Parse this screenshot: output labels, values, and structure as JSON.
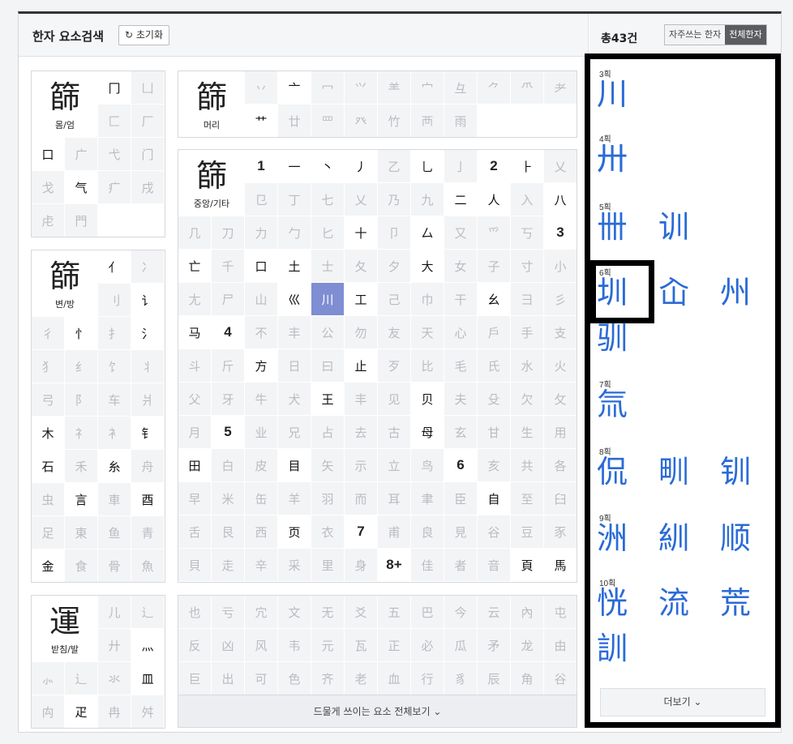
{
  "header": {
    "title": "한자 요소검색",
    "reset": "초기화",
    "reset_icon": "refresh-icon"
  },
  "right_header": {
    "count": "총43건",
    "tab_frequent": "자주쓰는 한자",
    "tab_all": "전체한자"
  },
  "sections": {
    "momeom": {
      "glyph_a": "",
      "glyph_b": "篩",
      "label": "몸/엄",
      "cells": [
        [
          "冂",
          "on"
        ],
        [
          "凵",
          "off"
        ],
        [
          "匚",
          "off"
        ],
        [
          "厂",
          "off"
        ],
        [
          "口",
          "on"
        ],
        [
          "广",
          "off"
        ],
        [
          "弋",
          "off"
        ],
        [
          "门",
          "off"
        ],
        [
          "戈",
          "off"
        ],
        [
          "气",
          "on"
        ],
        [
          "疒",
          "off"
        ],
        [
          "戌",
          "off"
        ],
        [
          "虍",
          "off"
        ],
        [
          "門",
          "off"
        ],
        [
          "",
          ""
        ],
        [
          "",
          ""
        ]
      ]
    },
    "meori": {
      "glyph": "篩",
      "label": "머리",
      "row1": [
        [
          "丷",
          "off"
        ],
        [
          "亠",
          "on"
        ],
        [
          "冖",
          "off"
        ],
        [
          "⺍",
          "off"
        ],
        [
          "⺷",
          "off"
        ],
        [
          "宀",
          "off"
        ],
        [
          "彑",
          "off"
        ],
        [
          "⺈",
          "off"
        ],
        [
          "⺥",
          "off"
        ],
        [
          "耂",
          "off"
        ]
      ],
      "row2": [
        [
          "艹",
          "on"
        ],
        [
          "廿",
          "off"
        ],
        [
          "罒",
          "off"
        ],
        [
          "癶",
          "off"
        ],
        [
          "竹",
          "off"
        ],
        [
          "襾",
          "off"
        ],
        [
          "雨",
          "off"
        ],
        [
          "",
          ""
        ],
        [
          "",
          ""
        ]
      ]
    },
    "center": {
      "glyph": "篩",
      "label": "중앙/기타",
      "cells": [
        [
          "1",
          "num"
        ],
        [
          "一",
          "on"
        ],
        [
          "丶",
          "on"
        ],
        [
          "丿",
          "on"
        ],
        [
          "乙",
          "off"
        ],
        [
          "乚",
          "on"
        ],
        [
          "亅",
          "off"
        ],
        [
          "2",
          "num"
        ],
        [
          "⺊",
          "on"
        ],
        [
          "乂",
          "off"
        ],
        [
          "⺋",
          "off"
        ],
        [
          "丁",
          "off"
        ],
        [
          "七",
          "off"
        ],
        [
          "乂",
          "off"
        ],
        [
          "乃",
          "off"
        ],
        [
          "九",
          "off"
        ],
        [
          "二",
          "on"
        ],
        [
          "人",
          "on"
        ],
        [
          "入",
          "off"
        ],
        [
          "八",
          "on"
        ],
        [
          "几",
          "off"
        ],
        [
          "刀",
          "off"
        ],
        [
          "力",
          "off"
        ],
        [
          "勹",
          "off"
        ],
        [
          "匕",
          "off"
        ],
        [
          "十",
          "on"
        ],
        [
          "卩",
          "off"
        ],
        [
          "厶",
          "on"
        ],
        [
          "又",
          "off"
        ],
        [
          "⺤",
          "off"
        ],
        [
          "丂",
          "off"
        ],
        [
          "3",
          "num"
        ],
        [
          "亡",
          "on"
        ],
        [
          "千",
          "off"
        ],
        [
          "口",
          "on"
        ],
        [
          "土",
          "on"
        ],
        [
          "士",
          "off"
        ],
        [
          "夂",
          "off"
        ],
        [
          "夕",
          "off"
        ],
        [
          "大",
          "on"
        ],
        [
          "女",
          "off"
        ],
        [
          "子",
          "off"
        ],
        [
          "寸",
          "off"
        ],
        [
          "小",
          "off"
        ],
        [
          "尢",
          "off"
        ],
        [
          "尸",
          "off"
        ],
        [
          "山",
          "off"
        ],
        [
          "巛",
          "on"
        ],
        [
          "川",
          "sel"
        ],
        [
          "工",
          "on"
        ],
        [
          "己",
          "off"
        ],
        [
          "巾",
          "off"
        ],
        [
          "干",
          "off"
        ],
        [
          "幺",
          "on"
        ],
        [
          "彐",
          "off"
        ],
        [
          "彡",
          "off"
        ],
        [
          "马",
          "on"
        ],
        [
          "4",
          "num"
        ],
        [
          "不",
          "off"
        ],
        [
          "丰",
          "off"
        ],
        [
          "公",
          "off"
        ],
        [
          "勿",
          "off"
        ],
        [
          "友",
          "off"
        ],
        [
          "天",
          "off"
        ],
        [
          "心",
          "off"
        ],
        [
          "戶",
          "off"
        ],
        [
          "手",
          "off"
        ],
        [
          "支",
          "off"
        ],
        [
          "斗",
          "off"
        ],
        [
          "斤",
          "off"
        ],
        [
          "方",
          "on"
        ],
        [
          "日",
          "off"
        ],
        [
          "曰",
          "off"
        ],
        [
          "止",
          "on"
        ],
        [
          "歹",
          "off"
        ],
        [
          "比",
          "off"
        ],
        [
          "毛",
          "off"
        ],
        [
          "氏",
          "off"
        ],
        [
          "水",
          "off"
        ],
        [
          "火",
          "off"
        ],
        [
          "父",
          "off"
        ],
        [
          "牙",
          "off"
        ],
        [
          "牛",
          "off"
        ],
        [
          "犬",
          "off"
        ],
        [
          "王",
          "on"
        ],
        [
          "丰",
          "off"
        ],
        [
          "见",
          "off"
        ],
        [
          "贝",
          "on"
        ],
        [
          "夫",
          "off"
        ],
        [
          "殳",
          "off"
        ],
        [
          "欠",
          "off"
        ],
        [
          "攵",
          "off"
        ],
        [
          "月",
          "off"
        ],
        [
          "5",
          "num"
        ],
        [
          "业",
          "off"
        ],
        [
          "兄",
          "off"
        ],
        [
          "占",
          "off"
        ],
        [
          "去",
          "off"
        ],
        [
          "古",
          "off"
        ],
        [
          "母",
          "on"
        ],
        [
          "玄",
          "off"
        ],
        [
          "甘",
          "off"
        ],
        [
          "生",
          "off"
        ],
        [
          "用",
          "off"
        ],
        [
          "田",
          "on"
        ],
        [
          "白",
          "off"
        ],
        [
          "皮",
          "off"
        ],
        [
          "目",
          "on"
        ],
        [
          "矢",
          "off"
        ],
        [
          "示",
          "off"
        ],
        [
          "立",
          "off"
        ],
        [
          "鸟",
          "off"
        ],
        [
          "6",
          "num"
        ],
        [
          "亥",
          "off"
        ],
        [
          "共",
          "off"
        ],
        [
          "各",
          "off"
        ],
        [
          "早",
          "off"
        ],
        [
          "米",
          "off"
        ],
        [
          "缶",
          "off"
        ],
        [
          "羊",
          "off"
        ],
        [
          "羽",
          "off"
        ],
        [
          "而",
          "off"
        ],
        [
          "耳",
          "off"
        ],
        [
          "聿",
          "off"
        ],
        [
          "臣",
          "off"
        ],
        [
          "自",
          "on"
        ],
        [
          "至",
          "off"
        ],
        [
          "臼",
          "off"
        ],
        [
          "舌",
          "off"
        ],
        [
          "艮",
          "off"
        ],
        [
          "西",
          "off"
        ],
        [
          "页",
          "on"
        ],
        [
          "衣",
          "off"
        ],
        [
          "7",
          "num"
        ],
        [
          "甫",
          "off"
        ],
        [
          "良",
          "off"
        ],
        [
          "見",
          "off"
        ],
        [
          "谷",
          "off"
        ],
        [
          "豆",
          "off"
        ],
        [
          "豕",
          "off"
        ],
        [
          "貝",
          "off"
        ],
        [
          "走",
          "off"
        ],
        [
          "辛",
          "off"
        ],
        [
          "采",
          "off"
        ],
        [
          "里",
          "off"
        ],
        [
          "身",
          "off"
        ],
        [
          "8+",
          "num"
        ],
        [
          "佳",
          "off"
        ],
        [
          "者",
          "off"
        ],
        [
          "音",
          "off"
        ],
        [
          "頁",
          "on"
        ],
        [
          "馬",
          "on"
        ]
      ]
    },
    "byeonbang": {
      "glyph": "篩",
      "label": "변/방",
      "cells": [
        [
          "亻",
          "on"
        ],
        [
          "冫",
          "off"
        ],
        [
          "刂",
          "off"
        ],
        [
          "讠",
          "on"
        ],
        [
          "彳",
          "off"
        ],
        [
          "忄",
          "on"
        ],
        [
          "扌",
          "off"
        ],
        [
          "氵",
          "on"
        ],
        [
          "犭",
          "off"
        ],
        [
          "纟",
          "off"
        ],
        [
          "饣",
          "off"
        ],
        [
          "丬",
          "off"
        ],
        [
          "弓",
          "off"
        ],
        [
          "阝",
          "off"
        ],
        [
          "车",
          "off"
        ],
        [
          "爿",
          "off"
        ],
        [
          "木",
          "on"
        ],
        [
          "礻",
          "off"
        ],
        [
          "衤",
          "off"
        ],
        [
          "钅",
          "on"
        ],
        [
          "石",
          "on"
        ],
        [
          "禾",
          "off"
        ],
        [
          "糸",
          "on"
        ],
        [
          "舟",
          "off"
        ],
        [
          "虫",
          "off"
        ],
        [
          "言",
          "on"
        ],
        [
          "車",
          "off"
        ],
        [
          "酉",
          "on"
        ],
        [
          "足",
          "off"
        ],
        [
          "東",
          "off"
        ],
        [
          "鱼",
          "off"
        ],
        [
          "青",
          "off"
        ],
        [
          "金",
          "on"
        ],
        [
          "食",
          "off"
        ],
        [
          "骨",
          "off"
        ],
        [
          "魚",
          "off"
        ]
      ]
    },
    "batchim": {
      "glyph": "運",
      "label": "받침/발",
      "cells": [
        [
          "儿",
          "off"
        ],
        [
          "辶",
          "off"
        ],
        [
          "廾",
          "off"
        ],
        [
          "灬",
          "on"
        ],
        [
          "⺗",
          "off"
        ],
        [
          "辶",
          "off"
        ],
        [
          "氺",
          "off"
        ],
        [
          "皿",
          "on"
        ],
        [
          "禸",
          "off"
        ],
        [
          "疋",
          "on"
        ],
        [
          "冉",
          "off"
        ],
        [
          "舛",
          "off"
        ]
      ]
    },
    "bottom": {
      "cells": [
        [
          "也",
          "off"
        ],
        [
          "亏",
          "off"
        ],
        [
          "宂",
          "off"
        ],
        [
          "文",
          "off"
        ],
        [
          "无",
          "off"
        ],
        [
          "爻",
          "off"
        ],
        [
          "五",
          "off"
        ],
        [
          "巴",
          "off"
        ],
        [
          "今",
          "off"
        ],
        [
          "云",
          "off"
        ],
        [
          "內",
          "off"
        ],
        [
          "屯",
          "off"
        ],
        [
          "反",
          "off"
        ],
        [
          "凶",
          "off"
        ],
        [
          "风",
          "off"
        ],
        [
          "韦",
          "off"
        ],
        [
          "元",
          "off"
        ],
        [
          "瓦",
          "off"
        ],
        [
          "正",
          "off"
        ],
        [
          "必",
          "off"
        ],
        [
          "瓜",
          "off"
        ],
        [
          "矛",
          "off"
        ],
        [
          "龙",
          "off"
        ],
        [
          "由",
          "off"
        ],
        [
          "巨",
          "off"
        ],
        [
          "出",
          "off"
        ],
        [
          "可",
          "off"
        ],
        [
          "色",
          "off"
        ],
        [
          "齐",
          "off"
        ],
        [
          "老",
          "off"
        ],
        [
          "血",
          "off"
        ],
        [
          "行",
          "off"
        ],
        [
          "豸",
          "off"
        ],
        [
          "辰",
          "off"
        ],
        [
          "角",
          "off"
        ],
        [
          "谷",
          "off"
        ]
      ],
      "more": "드물게 쓰이는 요소 전체보기"
    }
  },
  "results": {
    "more": "더보기",
    "groups": [
      {
        "stroke": "3획",
        "chars": [
          "川"
        ]
      },
      {
        "stroke": "4획",
        "chars": [
          "卅"
        ]
      },
      {
        "stroke": "5획",
        "chars": [
          "卌",
          "训"
        ]
      },
      {
        "stroke": "6획",
        "chars": [
          "圳",
          "屳",
          "州",
          "驯"
        ]
      },
      {
        "stroke": "7획",
        "chars": [
          "氚"
        ]
      },
      {
        "stroke": "8획",
        "chars": [
          "侃",
          "甽",
          "钏"
        ]
      },
      {
        "stroke": "9획",
        "chars": [
          "洲",
          "紃",
          "顺"
        ]
      },
      {
        "stroke": "10획",
        "chars": [
          "恍",
          "流",
          "荒",
          "訓"
        ]
      }
    ]
  }
}
